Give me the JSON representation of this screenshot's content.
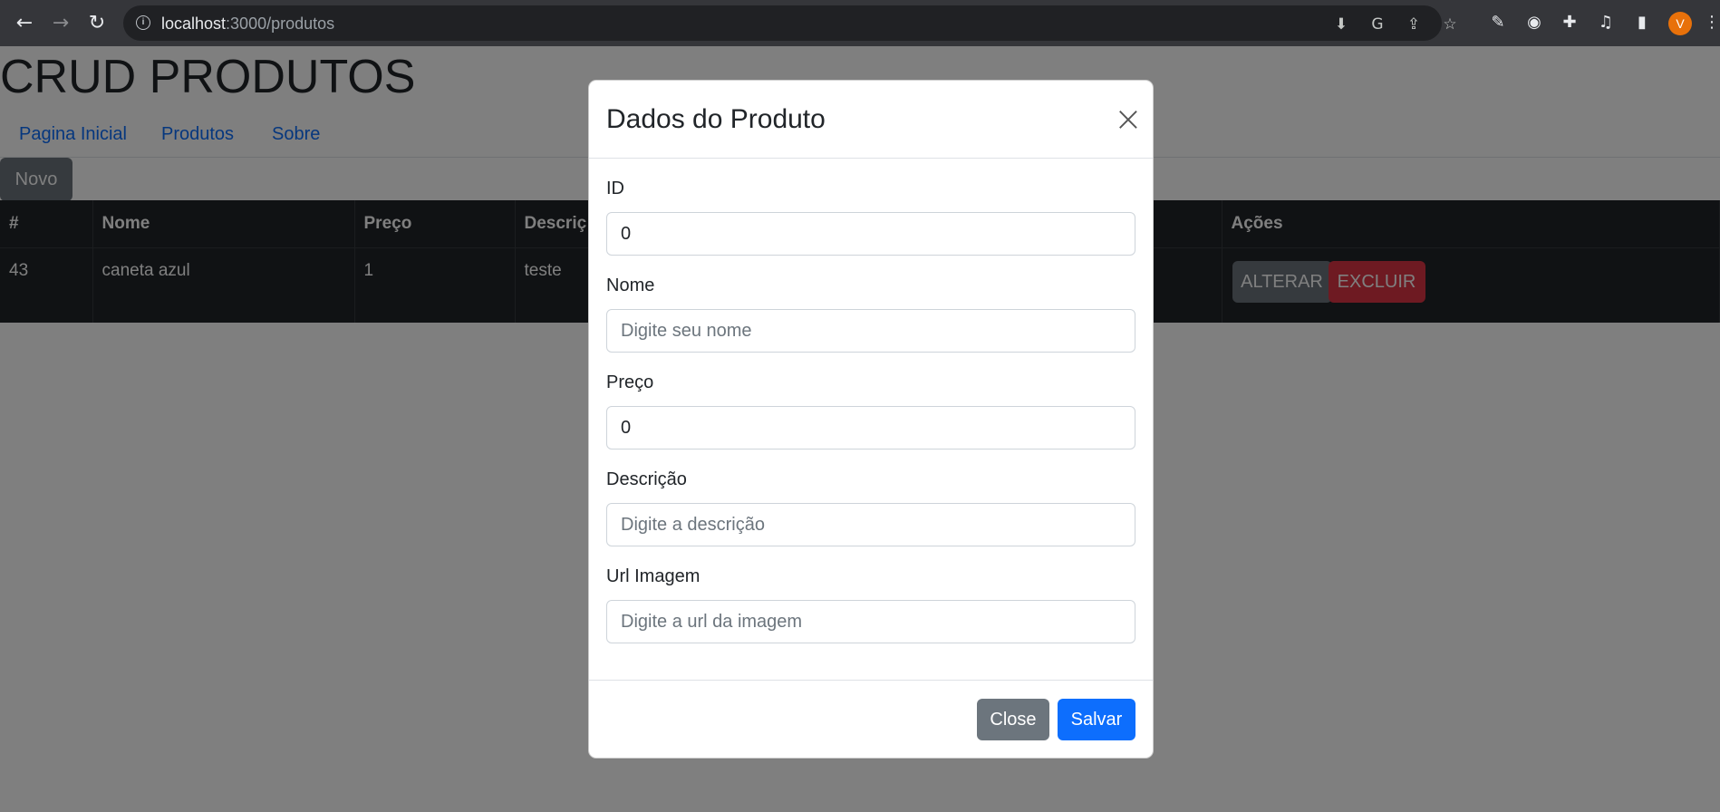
{
  "browser": {
    "url_host": "localhost",
    "url_path": ":3000/produtos",
    "avatar_letter": "V",
    "icons": [
      "back-icon",
      "forward-icon",
      "reload-icon",
      "info-icon",
      "install-icon",
      "translate-icon",
      "share-icon",
      "star-icon",
      "eyedropper-icon",
      "extension-circle-icon",
      "puzzle-icon",
      "media-icon",
      "sidepanel-icon",
      "menu-icon"
    ]
  },
  "app": {
    "title": "CRUD PRODUTOS",
    "nav": [
      "Pagina Inicial",
      "Produtos",
      "Sobre"
    ],
    "new_button": "Novo"
  },
  "table": {
    "headers": [
      "#",
      "Nome",
      "Preço",
      "Descriç",
      "Ações"
    ],
    "rows": [
      {
        "id": "43",
        "nome": "caneta azul",
        "preco": "1",
        "descricao": "teste"
      }
    ],
    "edit_button": "ALTERAR",
    "delete_button": "EXCLUIR"
  },
  "modal": {
    "title": "Dados do Produto",
    "fields": {
      "id": {
        "label": "ID",
        "value": "0",
        "placeholder": ""
      },
      "nome": {
        "label": "Nome",
        "value": "",
        "placeholder": "Digite seu nome"
      },
      "preco": {
        "label": "Preço",
        "value": "0",
        "placeholder": ""
      },
      "descricao": {
        "label": "Descrição",
        "value": "",
        "placeholder": "Digite a descrição"
      },
      "imagem": {
        "label": "Url Imagem",
        "value": "",
        "placeholder": "Digite a url da imagem"
      }
    },
    "close_button": "Close",
    "save_button": "Salvar"
  },
  "colors": {
    "primary": "#0d6efd",
    "secondary": "#6c757d",
    "danger": "#dc3545",
    "table_dark": "#212529"
  }
}
